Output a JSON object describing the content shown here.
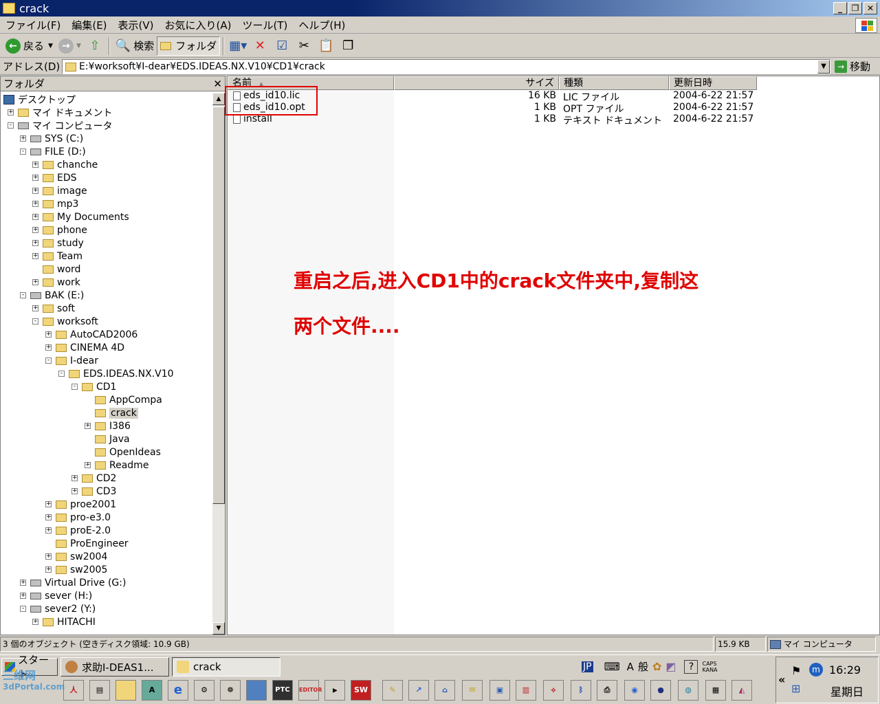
{
  "window": {
    "title": "crack"
  },
  "menu": [
    "ファイル(F)",
    "編集(E)",
    "表示(V)",
    "お気に入り(A)",
    "ツール(T)",
    "ヘルプ(H)"
  ],
  "toolbar": {
    "back_label": "戻る",
    "search_label": "検索",
    "folders_label": "フォルダ"
  },
  "address": {
    "label": "アドレス(D)",
    "path": "E:¥worksoft¥I-dear¥EDS.IDEAS.NX.V10¥CD1¥crack",
    "go_label": "移動"
  },
  "folder_pane": {
    "title": "フォルダ",
    "nodes": [
      {
        "label": "デスクトップ"
      },
      {
        "label": "マイ ドキュメント"
      },
      {
        "label": "マイ コンピュータ"
      },
      {
        "label": "SYS (C:)"
      },
      {
        "label": "FILE (D:)"
      },
      {
        "label": "chanche"
      },
      {
        "label": "EDS"
      },
      {
        "label": "image"
      },
      {
        "label": "mp3"
      },
      {
        "label": "My Documents"
      },
      {
        "label": "phone"
      },
      {
        "label": "study"
      },
      {
        "label": "Team"
      },
      {
        "label": "word"
      },
      {
        "label": "work"
      },
      {
        "label": "BAK (E:)"
      },
      {
        "label": "soft"
      },
      {
        "label": "worksoft"
      },
      {
        "label": "AutoCAD2006"
      },
      {
        "label": "CINEMA 4D"
      },
      {
        "label": "I-dear"
      },
      {
        "label": "EDS.IDEAS.NX.V10"
      },
      {
        "label": "CD1"
      },
      {
        "label": "AppCompa"
      },
      {
        "label": "crack"
      },
      {
        "label": "I386"
      },
      {
        "label": "Java"
      },
      {
        "label": "OpenIdeas"
      },
      {
        "label": "Readme"
      },
      {
        "label": "CD2"
      },
      {
        "label": "CD3"
      },
      {
        "label": "proe2001"
      },
      {
        "label": "pro-e3.0"
      },
      {
        "label": "proE-2.0"
      },
      {
        "label": "ProEngineer"
      },
      {
        "label": "sw2004"
      },
      {
        "label": "sw2005"
      },
      {
        "label": "Virtual Drive (G:)"
      },
      {
        "label": "sever (H:)"
      },
      {
        "label": "sever2 (Y:)"
      },
      {
        "label": "HITACHI"
      }
    ]
  },
  "file_list": {
    "columns": {
      "name": "名前",
      "size": "サイズ",
      "type": "種類",
      "modified": "更新日時"
    },
    "rows": [
      {
        "name": "eds_id10.lic",
        "size": "16 KB",
        "type": "LIC ファイル",
        "modified": "2004-6-22 21:57"
      },
      {
        "name": "eds_id10.opt",
        "size": "1 KB",
        "type": "OPT ファイル",
        "modified": "2004-6-22 21:57"
      },
      {
        "name": "install",
        "size": "1 KB",
        "type": "テキスト ドキュメント",
        "modified": "2004-6-22 21:57"
      }
    ]
  },
  "annotation": {
    "line1": "重启之后,进入CD1中的crack文件夹中,复制这",
    "line2": "两个文件...."
  },
  "status": {
    "objects": "3 個のオブジェクト (空きディスク領域: 10.9 GB)",
    "size": "15.9 KB",
    "location": "マイ コンピュータ"
  },
  "taskbar": {
    "start_label": "スタート",
    "tasks": [
      "求助I-DEAS1...",
      "crack"
    ],
    "ime": {
      "lang": "JP",
      "mode_a": "A",
      "mode_kanji": "般",
      "caps": "CAPS",
      "kana": "KANA"
    },
    "quicklaunch": [
      "PTC",
      "EDITOR",
      "SW"
    ],
    "clock": "16:29",
    "weekday": "星期日",
    "watermark_line1": "三维网",
    "watermark_line2": "3dPortal.com"
  },
  "colors": {
    "annotation": "#e00000",
    "title_bar": "#0a246a",
    "face": "#d4d0c8"
  }
}
